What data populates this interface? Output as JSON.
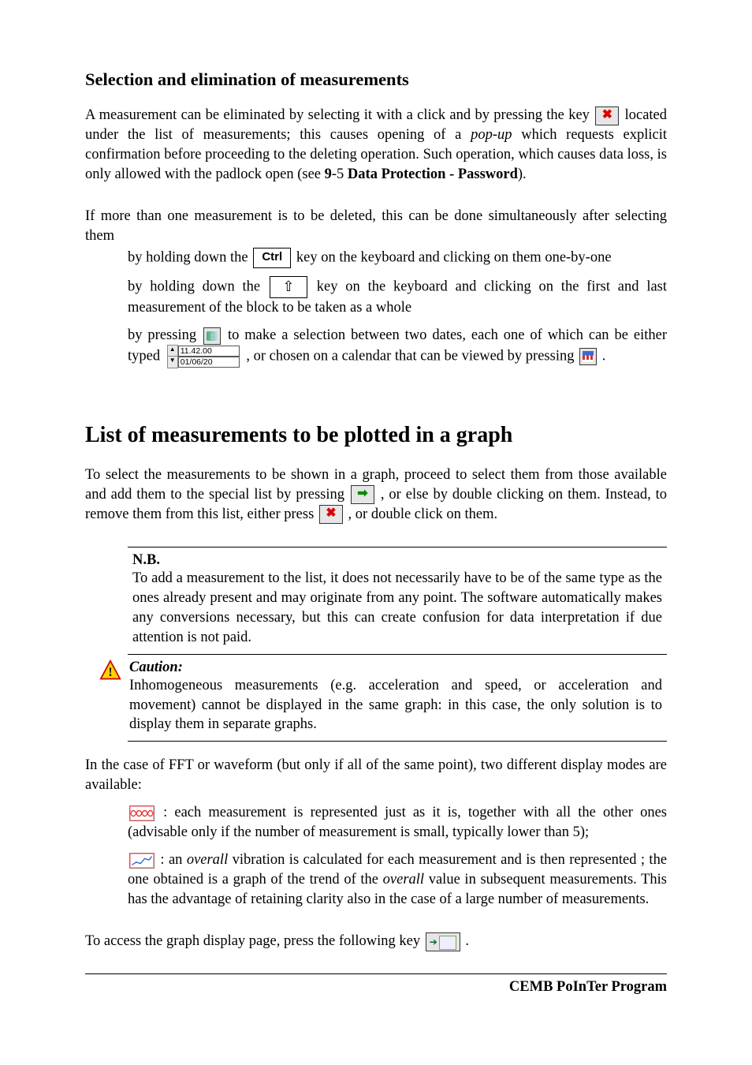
{
  "section1": {
    "title": "Selection and elimination of measurements",
    "p1_a": "A measurement can be eliminated by selecting it with a click and by pressing the key",
    "p1_b": "located under the list of measurements; this causes opening of a",
    "p1_popup": "pop-up",
    "p1_c": "which requests explicit confirmation before proceeding to the deleting operation. Such operation, which causes data loss, is only allowed with the padlock open (see",
    "p1_ref": "9",
    "p1_refb": "-5",
    "p1_reftitle": "Data Protection - Password",
    "p1_end": ").",
    "p2": "If more than one measurement is to be deleted, this can be done simultaneously after selecting them",
    "b1_a": "by holding down the",
    "ctrl": "Ctrl",
    "b1_b": "key on the keyboard and clicking on them one-by-one",
    "b2_a": "by holding down the",
    "shift": "⇧",
    "b2_b": "key on the keyboard and clicking on the first and last measurement of the block to be taken as a whole",
    "b3_a": "by pressing",
    "b3_b": "to make a selection between two dates, each one of which can be either typed",
    "dt_time": "11.42.00",
    "dt_date": "01/06/20",
    "b3_c": ", or chosen on a calendar that can be viewed by pressing",
    "b3_d": "."
  },
  "section2": {
    "title": "List of measurements to be plotted in a graph",
    "p1_a": "To select the measurements to be shown in a graph, proceed to select them from those available and add them to the special list by pressing",
    "p1_b": ", or else by double clicking on them. Instead, to remove them from this list,  either press",
    "p1_c": ", or double click on them.",
    "nb_title": "N.B.",
    "nb_body": "To add a measurement to the list, it does not necessarily have to be of the same type as the ones already present and may originate from any point. The software automatically makes any conversions necessary, but this can create confusion for data interpretation if due attention is not paid.",
    "caution_title": "Caution:",
    "caution_body": "Inhomogeneous measurements (e.g. acceleration and speed, or acceleration and movement) cannot be displayed in the same graph: in this case, the only solution is to display them in separate graphs.",
    "p2": "In the case of FFT or waveform (but only if all of the same point), two different display modes are available:",
    "mode1": ": each measurement is represented just as it is, together with all the other ones (advisable only if the number of measurement is small, typically lower than 5);",
    "mode2_a": ": an",
    "mode2_overall": "overall",
    "mode2_b": "vibration is calculated for each measurement and is then represented ; the one obtained is a graph of the trend of the",
    "mode2_c": "value in subsequent measurements. This has the advantage of retaining clarity also in the case of a large number of measurements.",
    "p3_a": "To access the graph display page, press the following key",
    "p3_b": "."
  },
  "footer": "CEMB PoInTer Program"
}
